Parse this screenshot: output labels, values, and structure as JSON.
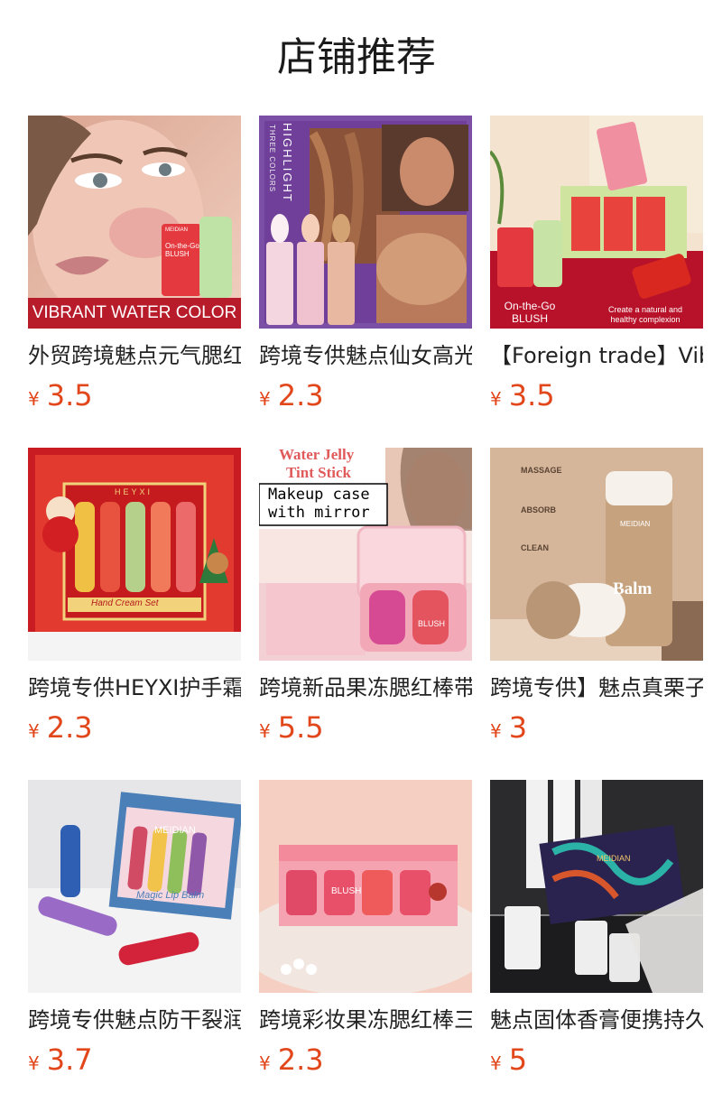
{
  "page": {
    "title": "店铺推荐"
  },
  "currency": "¥",
  "products": [
    {
      "name": "外贸跨境魅点元气腮红棒",
      "price": "3.5",
      "image": {
        "caption": "VIBRANT WATER COLOR",
        "product_text": "On-the-Go BLUSH",
        "brand": "MEIDIAN"
      }
    },
    {
      "name": "跨境专供魅点仙女高光棒",
      "price": "2.3",
      "image": {
        "side_text_1": "HIGHLIGHT",
        "side_text_2": "THREE COLORS"
      }
    },
    {
      "name": "【Foreign trade】Vibrant",
      "price": "3.5",
      "image": {
        "caption_left": "On-the-Go BLUSH",
        "caption_right": "Create a natural and healthy complexion"
      }
    },
    {
      "name": "跨境专供HEYXI护手霜套装",
      "price": "2.3",
      "image": {
        "brand": "HEYXI",
        "product_text": "Hand Cream Set"
      }
    },
    {
      "name": "跨境新品果冻腮红棒带镜子",
      "price": "5.5",
      "image": {
        "heading_1": "Water Jelly",
        "heading_2": "Tint Stick",
        "note_1": "Makeup case",
        "note_2": "with mirror",
        "product_text": "BLUSH"
      }
    },
    {
      "name": "跨境专供】魅点真栗子卸妆膏",
      "price": "3",
      "image": {
        "step_1": "MASSAGE",
        "step_2": "ABSORB",
        "step_3": "CLEAN",
        "product_text": "Balm",
        "brand": "MEIDIAN"
      }
    },
    {
      "name": "跨境专供魅点防干裂润唇膏",
      "price": "3.7",
      "image": {
        "brand": "MEIDIAN",
        "product_text": "Magic Lip Balm"
      }
    },
    {
      "name": "跨境彩妆果冻腮红棒三合一",
      "price": "2.3",
      "image": {
        "product_text": "BLUSH"
      }
    },
    {
      "name": "魅点固体香膏便携持久",
      "price": "5",
      "image": {
        "brand": "MEIDIAN"
      }
    }
  ]
}
